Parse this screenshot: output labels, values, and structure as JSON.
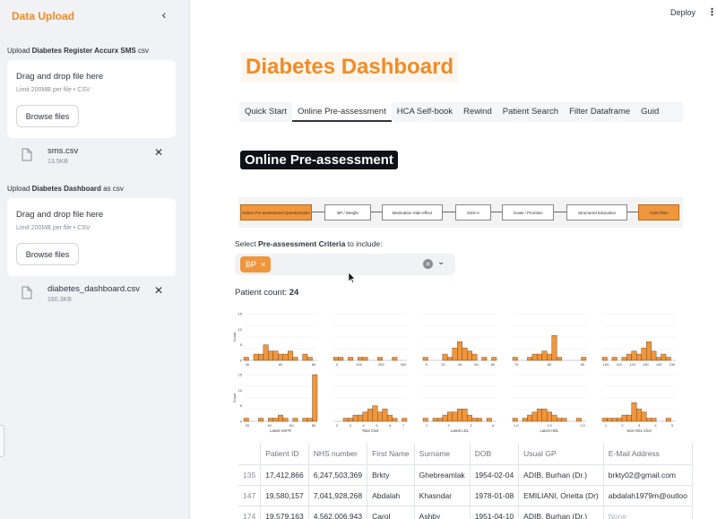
{
  "sidebar": {
    "title": "Data Upload",
    "uploaders": [
      {
        "label_prefix": "Upload ",
        "label_bold": "Diabetes Register Accurx SMS",
        "label_suffix": " csv",
        "drop_title": "Drag and drop file here",
        "drop_sub": "Limit 200MB per file • CSV",
        "browse": "Browse files",
        "file_name": "sms.csv",
        "file_size": "13.5KB"
      },
      {
        "label_prefix": "Upload ",
        "label_bold": "Diabetes Dashboard",
        "label_suffix": " as csv",
        "drop_title": "Drag and drop file here",
        "drop_sub": "Limit 200MB per file • CSV",
        "browse": "Browse files",
        "file_name": "diabetes_dashboard.csv",
        "file_size": "160.3KB"
      }
    ]
  },
  "header": {
    "deploy": "Deploy",
    "menu": "⋮"
  },
  "dashboard_title": "Diabetes Dashboard",
  "tabs": [
    "Quick Start",
    "Online Pre-assessment",
    "HCA Self-book",
    "Rewind",
    "Patient Search",
    "Filter Dataframe",
    "Guid"
  ],
  "section_title": "Online Pre-assessment",
  "flow": [
    "Online Pre-assessment Questionnaire",
    "BP / Weight",
    "Medication Side-effect",
    "DDS-2",
    "Goals / Priorities",
    "Structured Education",
    "Care Plan"
  ],
  "select": {
    "label_prefix": "Select ",
    "label_bold": "Pre-assessment Criteria",
    "label_suffix": " to include:",
    "chips": [
      "BP"
    ]
  },
  "count": {
    "label": "Patient count: ",
    "value": "24"
  },
  "chart_data": [
    {
      "type": "bar",
      "ylabel": "Count",
      "xlabel": "",
      "xticks": [
        "40",
        "60",
        "80"
      ],
      "ylim": [
        0,
        15
      ],
      "yticks": [
        "0",
        "5",
        "10",
        "15"
      ],
      "values": [
        1,
        0,
        2,
        2,
        5,
        3,
        3,
        2,
        2,
        3,
        1,
        0,
        2,
        1,
        0
      ]
    },
    {
      "type": "bar",
      "xlabel": "",
      "xticks": [
        "0",
        "100",
        "200",
        "300"
      ],
      "ylim": [
        0,
        15
      ],
      "values": [
        1,
        1,
        0,
        1,
        0,
        1,
        1,
        0,
        0,
        1,
        0,
        0,
        1,
        0,
        0
      ]
    },
    {
      "type": "bar",
      "xlabel": "",
      "xticks": [
        "0",
        "20",
        "40",
        "60",
        "80"
      ],
      "ylim": [
        0,
        15
      ],
      "values": [
        1,
        0,
        0,
        0,
        2,
        1,
        4,
        6,
        4,
        3,
        2,
        0,
        1,
        0,
        1
      ]
    },
    {
      "type": "bar",
      "xlabel": "",
      "xticks": [
        "70",
        "80",
        "90"
      ],
      "ylim": [
        0,
        15
      ],
      "values": [
        1,
        0,
        0,
        1,
        2,
        2,
        3,
        2,
        8,
        1,
        0,
        0,
        0,
        0,
        1
      ]
    },
    {
      "type": "bar",
      "xlabel": "",
      "xticks": [
        "100",
        "110",
        "120",
        "130",
        "140",
        "150"
      ],
      "ylim": [
        0,
        15
      ],
      "values": [
        1,
        0,
        1,
        0,
        1,
        2,
        3,
        2,
        4,
        6,
        3,
        1,
        2,
        1,
        0
      ]
    },
    {
      "type": "bar",
      "ylabel": "Count",
      "xlabel": "Latest eGFR",
      "xticks": [
        "20",
        "40",
        "60",
        "80"
      ],
      "ylim": [
        0,
        15
      ],
      "yticks": [
        "0",
        "5",
        "10",
        "15"
      ],
      "values": [
        1,
        0,
        0,
        1,
        0,
        1,
        1,
        2,
        1,
        0,
        1,
        0,
        1,
        1,
        15
      ]
    },
    {
      "type": "bar",
      "xlabel": "Total Chol",
      "xticks": [
        "2",
        "3",
        "4",
        "5",
        "6",
        "7"
      ],
      "ylim": [
        0,
        15
      ],
      "values": [
        0,
        0,
        1,
        1,
        2,
        2,
        3,
        4,
        5,
        3,
        4,
        2,
        1,
        0,
        1
      ]
    },
    {
      "type": "bar",
      "xlabel": "Latest LDL",
      "xticks": [
        "1",
        "2",
        "3",
        "4"
      ],
      "ylim": [
        0,
        15
      ],
      "values": [
        1,
        0,
        1,
        1,
        2,
        3,
        3,
        4,
        4,
        2,
        1,
        1,
        0,
        1,
        0
      ]
    },
    {
      "type": "bar",
      "xlabel": "Latest HDL",
      "xticks": [
        "1.0",
        "1.5",
        "2.0"
      ],
      "ylim": [
        0,
        15
      ],
      "values": [
        1,
        0,
        1,
        2,
        3,
        4,
        4,
        3,
        2,
        1,
        1,
        0,
        0,
        1,
        0
      ]
    },
    {
      "type": "bar",
      "xlabel": "Non-HDL Chol",
      "xticks": [
        "1",
        "2",
        "3",
        "4",
        "5"
      ],
      "ylim": [
        0,
        15
      ],
      "values": [
        1,
        1,
        1,
        1,
        2,
        2,
        6,
        4,
        3,
        1,
        1,
        0,
        0,
        1,
        0
      ]
    }
  ],
  "table": {
    "headers": [
      "",
      "Patient ID",
      "NHS number",
      "First Name",
      "Surname",
      "DOB",
      "Usual GP",
      "E-Mail Address"
    ],
    "rows": [
      [
        "135",
        "17,412,866",
        "6,247,503,369",
        "Brkty",
        "Ghebreamlak",
        "1954-02-04",
        "ADIB, Burhan (Dr.)",
        "brkty02@gmail.com"
      ],
      [
        "147",
        "19,580,157",
        "7,041,928,268",
        "Abdalah",
        "Khasndar",
        "1978-01-08",
        "EMILIANI, Orietta (Dr)",
        "abdalah1979m@outloo"
      ],
      [
        "174",
        "19,579,163",
        "4,562,006,943",
        "Carol",
        "Ashby",
        "1951-04-10",
        "ADIB, Burhan (Dr.)",
        "None"
      ]
    ]
  },
  "colors": {
    "accent": "#f28b24",
    "bar": "#f0963c",
    "bar_edge": "#5a3a1a"
  }
}
